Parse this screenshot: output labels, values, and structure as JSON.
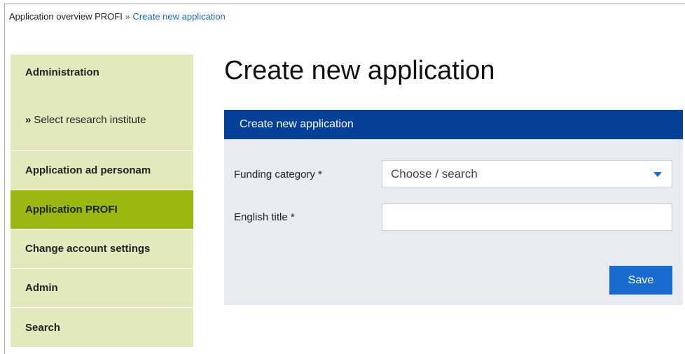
{
  "breadcrumb": {
    "parent": "Application overview PROFI",
    "separator": "»",
    "current": "Create new application"
  },
  "sidebar": {
    "items": [
      {
        "label": "Administration",
        "prefix": ""
      },
      {
        "label": "Select research institute",
        "prefix": "»"
      },
      {
        "label": "Application ad personam",
        "prefix": ""
      },
      {
        "label": "Application PROFI",
        "prefix": "",
        "active": true
      },
      {
        "label": "Change account settings",
        "prefix": ""
      },
      {
        "label": "Admin",
        "prefix": ""
      },
      {
        "label": "Search",
        "prefix": ""
      }
    ]
  },
  "page": {
    "title": "Create new application"
  },
  "panel": {
    "header": "Create new application",
    "funding_label": "Funding category *",
    "funding_placeholder": "Choose / search",
    "title_label": "English title *",
    "title_value": "",
    "save_label": "Save"
  },
  "colors": {
    "sidebar_bg": "#e3e8bd",
    "sidebar_active": "#9bb712",
    "panel_header": "#054199",
    "panel_bg": "#e8ebf0",
    "accent": "#1a6bd0",
    "link": "#1a6bb5"
  }
}
